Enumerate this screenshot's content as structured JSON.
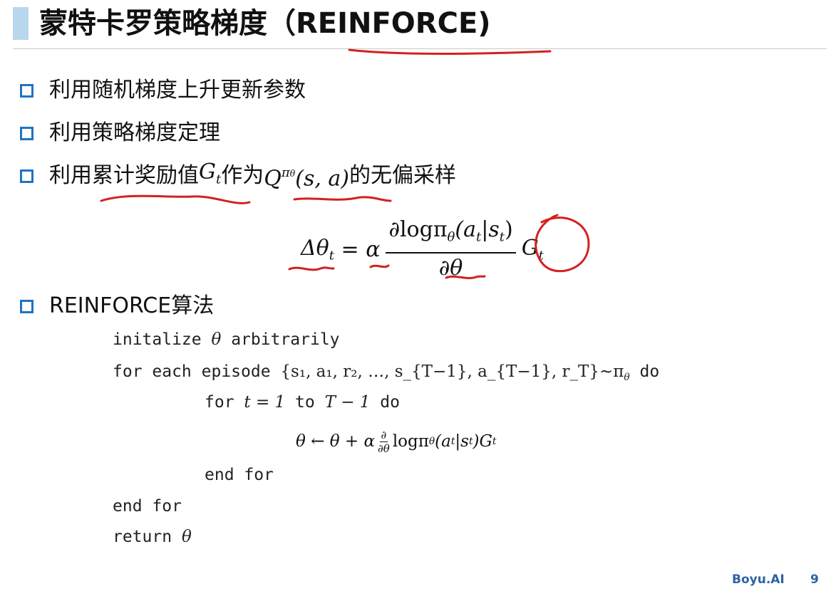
{
  "slide": {
    "title": "蒙特卡罗策略梯度（REINFORCE)",
    "bullets": [
      "利用随机梯度上升更新参数",
      "利用策略梯度定理"
    ],
    "bullet3": {
      "before": "利用累计奖励值",
      "g": "G",
      "g_sub": "t",
      "middle": "作为",
      "q": "Q",
      "q_sup": "π",
      "q_sup_sub": "θ",
      "q_args": "(s, a)",
      "after": "的无偏采样"
    },
    "formula": {
      "lhs": "Δθ",
      "lhs_sub": "t",
      "eq": " = ",
      "alpha": "α",
      "numerator": "∂logπ",
      "numerator_sub": "θ",
      "numerator_args": "(a",
      "numerator_args_sub": "t",
      "numerator_bar": "|s",
      "numerator_bar_sub": "t",
      "numerator_close": ")",
      "denominator": "∂θ",
      "g": "G",
      "g_sub": "t"
    },
    "algorithm_heading": "REINFORCE算法",
    "algorithm": {
      "line1_kw": "initalize ",
      "line1_theta": "θ",
      "line1_rest": " arbitrarily",
      "line2_kw": "for each episode ",
      "line2_episode": "{s₁, a₁, r₂, …, s_{T−1}, a_{T−1}, r_T}~π",
      "line2_sub": "θ",
      "line2_do": " do",
      "line3_kw": "for ",
      "line3_expr": "t = 1",
      "line3_to": " to ",
      "line3_expr2": "T − 1",
      "line3_do": " do",
      "update_lhs": "θ ← θ + α",
      "update_frac_num": "∂",
      "update_frac_den": "∂θ",
      "update_rest": "logπ",
      "update_sub": "θ",
      "update_args": "(a",
      "update_args_sub": "t",
      "update_bar": "|s",
      "update_bar_sub": "t",
      "update_close": ")G",
      "update_g_sub": "t",
      "line5": "end for",
      "line6": "end for",
      "line7_kw": "return ",
      "line7_theta": "θ"
    },
    "footer": {
      "brand": "Boyu.AI",
      "page": "9"
    }
  },
  "colors": {
    "accent": "#b9d7ec",
    "bullet": "#1f74c4",
    "footer": "#2f62a5",
    "ink": "#d42020"
  }
}
